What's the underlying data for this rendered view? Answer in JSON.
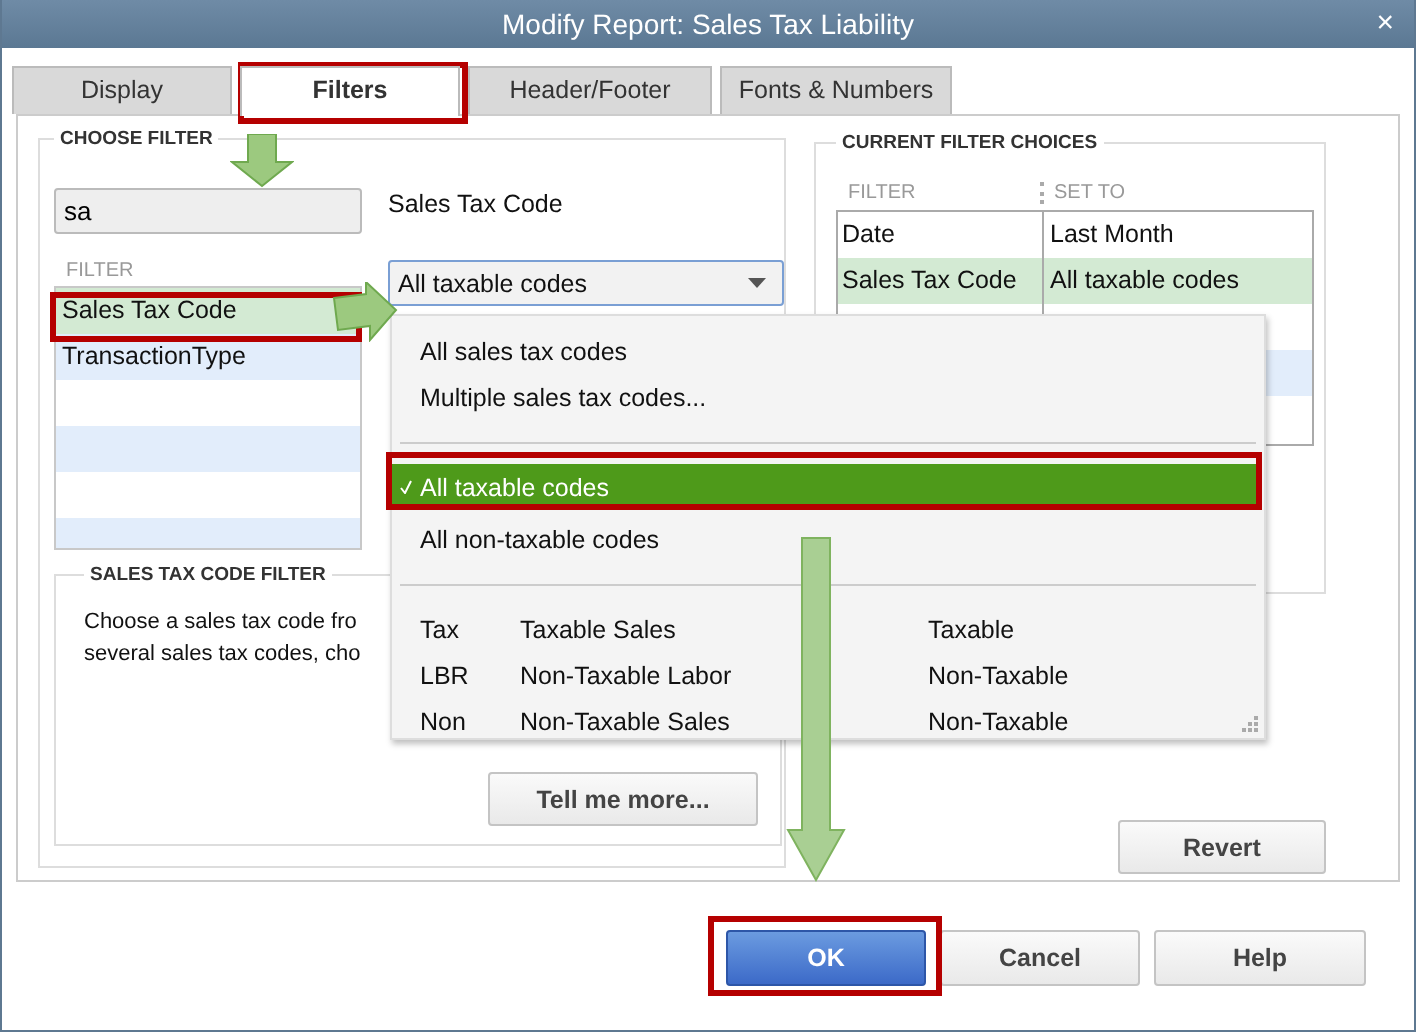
{
  "window": {
    "title": "Modify Report: Sales Tax Liability",
    "close": "×"
  },
  "tabs": [
    {
      "label": "Display",
      "selected": false
    },
    {
      "label": "Filters",
      "selected": true
    },
    {
      "label": "Header/Footer",
      "selected": false
    },
    {
      "label": "Fonts & Numbers",
      "selected": false
    }
  ],
  "choose_filter": {
    "heading": "CHOOSE FILTER",
    "search": {
      "value": "sa"
    },
    "field_label": "Sales Tax Code",
    "list_header": "FILTER",
    "filters": [
      {
        "label": "Sales Tax Code",
        "selected": true
      },
      {
        "label": "TransactionType",
        "selected": false
      }
    ],
    "combobox": {
      "value": "All taxable codes",
      "expanded": true
    }
  },
  "dropdown": {
    "items": [
      {
        "kind": "option",
        "label": "All sales tax codes",
        "selected": false
      },
      {
        "kind": "option",
        "label": "Multiple sales tax codes...",
        "selected": false
      },
      {
        "kind": "separator"
      },
      {
        "kind": "option",
        "label": "All taxable codes",
        "selected": true
      },
      {
        "kind": "option",
        "label": "All non-taxable codes",
        "selected": false
      },
      {
        "kind": "separator"
      },
      {
        "kind": "code",
        "code": "Tax",
        "name": "Taxable Sales",
        "type": "Taxable"
      },
      {
        "kind": "code",
        "code": "LBR",
        "name": "Non-Taxable Labor",
        "type": "Non-Taxable"
      },
      {
        "kind": "code",
        "code": "Non",
        "name": "Non-Taxable Sales",
        "type": "Non-Taxable"
      }
    ]
  },
  "code_filter": {
    "heading": "SALES TAX CODE FILTER",
    "lines": [
      "Choose a sales tax code fro",
      "several sales tax codes, cho"
    ],
    "button": "Tell me more..."
  },
  "current_choices": {
    "heading": "CURRENT FILTER CHOICES",
    "columns": [
      "FILTER",
      "SET TO"
    ],
    "rows": [
      {
        "filter": "Date",
        "set_to": "Last Month",
        "selected": false
      },
      {
        "filter": "Sales Tax Code",
        "set_to": "All taxable codes",
        "selected": true
      }
    ]
  },
  "revert": "Revert",
  "buttons": [
    {
      "label": "OK",
      "primary": true
    },
    {
      "label": "Cancel",
      "primary": false
    },
    {
      "label": "Help",
      "primary": false
    }
  ]
}
